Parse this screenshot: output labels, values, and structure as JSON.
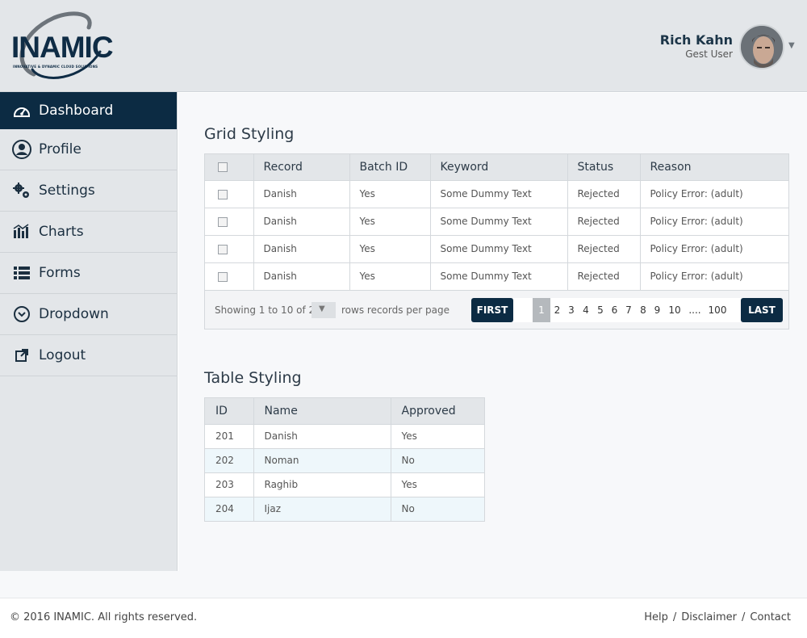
{
  "brand": {
    "logo_text": "INAMIC",
    "tagline": "INNOVATIVE & DYNAMIC CLOUD SOLUTIONS"
  },
  "user": {
    "name": "Rich Kahn",
    "role": "Gest User"
  },
  "sidebar": {
    "items": [
      {
        "label": "Dashboard",
        "icon": "dashboard-icon",
        "active": true
      },
      {
        "label": "Profile",
        "icon": "user-icon"
      },
      {
        "label": "Settings",
        "icon": "gears-icon"
      },
      {
        "label": "Charts",
        "icon": "chart-icon"
      },
      {
        "label": "Forms",
        "icon": "list-icon"
      },
      {
        "label": "Dropdown",
        "icon": "chevron-circle-icon"
      },
      {
        "label": "Logout",
        "icon": "external-link-icon"
      }
    ]
  },
  "grid": {
    "title": "Grid Styling",
    "columns": [
      "Record",
      "Batch ID",
      "Keyword",
      "Status",
      "Reason"
    ],
    "rows": [
      [
        "Danish",
        "Yes",
        "Some Dummy Text",
        "Rejected",
        "Policy Error: (adult)"
      ],
      [
        "Danish",
        "Yes",
        "Some Dummy Text",
        "Rejected",
        "Policy Error: (adult)"
      ],
      [
        "Danish",
        "Yes",
        "Some Dummy Text",
        "Rejected",
        "Policy Error: (adult)"
      ],
      [
        "Danish",
        "Yes",
        "Some Dummy Text",
        "Rejected",
        "Policy Error: (adult)"
      ]
    ],
    "pager": {
      "info": "Showing 1 to 10 of 21",
      "rows_label": "rows records per page",
      "first": "FIRST",
      "last": "LAST",
      "pages": [
        "1",
        "2",
        "3",
        "4",
        "5",
        "6",
        "7",
        "8",
        "9",
        "10",
        "....",
        "100"
      ],
      "current": "1"
    }
  },
  "table": {
    "title": "Table Styling",
    "columns": [
      "ID",
      "Name",
      "Approved"
    ],
    "rows": [
      [
        "201",
        "Danish",
        "Yes"
      ],
      [
        "202",
        "Noman",
        "No"
      ],
      [
        "203",
        "Raghib",
        "Yes"
      ],
      [
        "204",
        "Ijaz",
        "No"
      ]
    ]
  },
  "footer": {
    "copyright": "© 2016 INAMIC. All rights reserved.",
    "links": [
      "Help",
      "Disclaimer",
      "Contact"
    ]
  },
  "colors": {
    "brand_dark": "#0c2b43",
    "sidebar_bg": "#e3e6e9",
    "row_alt": "#eef7fb"
  }
}
